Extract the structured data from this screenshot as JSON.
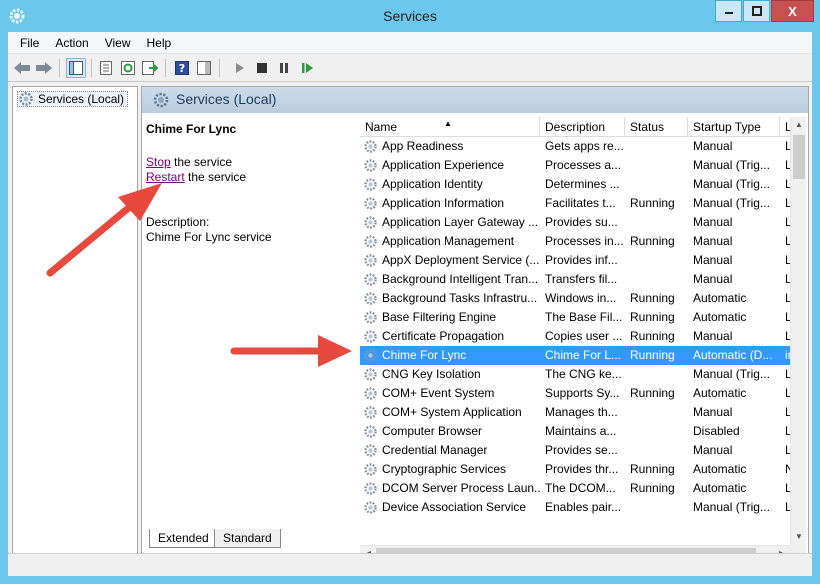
{
  "window": {
    "title": "Services",
    "minimize": "–",
    "close": "X"
  },
  "menu": [
    "File",
    "Action",
    "View",
    "Help"
  ],
  "tree": {
    "root_label": "Services (Local)"
  },
  "pane": {
    "header": "Services (Local)",
    "service_title": "Chime For Lync",
    "stop_link": "Stop",
    "stop_text": " the service",
    "restart_link": "Restart",
    "restart_text": " the service",
    "description_label": "Description:",
    "description_text": "Chime For Lync service"
  },
  "columns": [
    "Name",
    "Description",
    "Status",
    "Startup Type",
    "Lo"
  ],
  "rows": [
    [
      "App Readiness",
      "Gets apps re...",
      "",
      "Manual",
      "Lo"
    ],
    [
      "Application Experience",
      "Processes a...",
      "",
      "Manual (Trig...",
      "Lo"
    ],
    [
      "Application Identity",
      "Determines ...",
      "",
      "Manual (Trig...",
      "Lo"
    ],
    [
      "Application Information",
      "Facilitates t...",
      "Running",
      "Manual (Trig...",
      "Lo"
    ],
    [
      "Application Layer Gateway ...",
      "Provides su...",
      "",
      "Manual",
      "Lo"
    ],
    [
      "Application Management",
      "Processes in...",
      "Running",
      "Manual",
      "Lo"
    ],
    [
      "AppX Deployment Service (...",
      "Provides inf...",
      "",
      "Manual",
      "Lo"
    ],
    [
      "Background Intelligent Tran...",
      "Transfers fil...",
      "",
      "Manual",
      "Lo"
    ],
    [
      "Background Tasks Infrastru...",
      "Windows in...",
      "Running",
      "Automatic",
      "Lo"
    ],
    [
      "Base Filtering Engine",
      "The Base Fil...",
      "Running",
      "Automatic",
      "Lo"
    ],
    [
      "Certificate Propagation",
      "Copies user ...",
      "Running",
      "Manual",
      "Lo"
    ],
    [
      "Chime For Lync",
      "Chime For L...",
      "Running",
      "Automatic (D...",
      "ins"
    ],
    [
      "CNG Key Isolation",
      "The CNG ke...",
      "",
      "Manual (Trig...",
      "Lo"
    ],
    [
      "COM+ Event System",
      "Supports Sy...",
      "Running",
      "Automatic",
      "Lo"
    ],
    [
      "COM+ System Application",
      "Manages th...",
      "",
      "Manual",
      "Lo"
    ],
    [
      "Computer Browser",
      "Maintains a...",
      "",
      "Disabled",
      "Lo"
    ],
    [
      "Credential Manager",
      "Provides se...",
      "",
      "Manual",
      "Lo"
    ],
    [
      "Cryptographic Services",
      "Provides thr...",
      "Running",
      "Automatic",
      "Ne"
    ],
    [
      "DCOM Server Process Laun...",
      "The DCOM...",
      "Running",
      "Automatic",
      "Lo"
    ],
    [
      "Device Association Service",
      "Enables pair...",
      "",
      "Manual (Trig...",
      "Lo"
    ]
  ],
  "selected_row": 11,
  "tabs": [
    "Extended",
    "Standard"
  ],
  "colors": {
    "titlebar": "#6bc8ec",
    "selection": "#3399ff",
    "arrow": "#e8493e",
    "link": "#800080"
  }
}
